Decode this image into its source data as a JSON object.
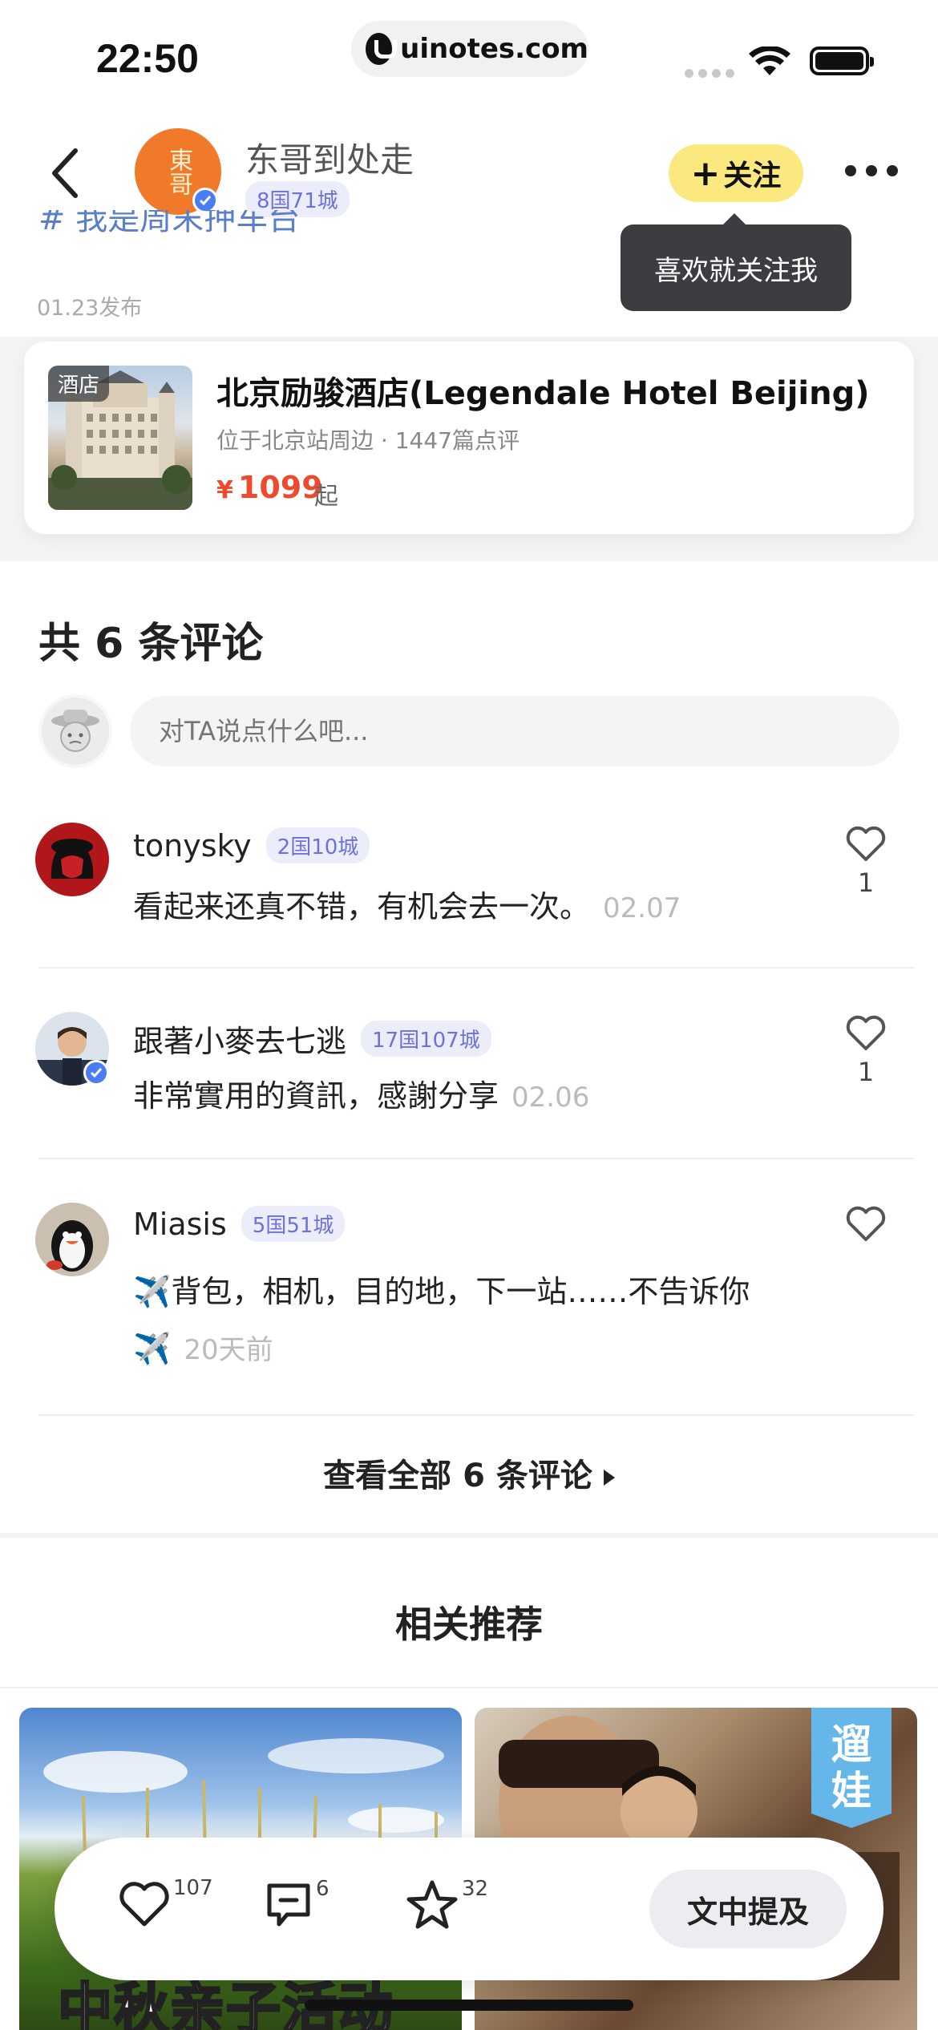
{
  "status_bar": {
    "time": "22:50",
    "url": "uinotes.com"
  },
  "header": {
    "author_name": "东哥到处走",
    "author_avatar_text": "東哥",
    "author_badge": "8国71城",
    "follow_label": "关注",
    "tooltip": "喜欢就关注我"
  },
  "post": {
    "truncated_text": "# 我是周末押车台",
    "publish_date": "01.23发布"
  },
  "hotel": {
    "tag": "酒店",
    "name": "北京励骏酒店(Legendale Hotel Beijing)",
    "location": "位于北京站周边 · 1447篇点评",
    "currency": "¥",
    "price": "1099",
    "price_suffix": "起"
  },
  "comments": {
    "title": "共 6 条评论",
    "input_placeholder": "对TA说点什么吧...",
    "items": [
      {
        "name": "tonysky",
        "badge": "2国10城",
        "text": "看起来还真不错，有机会去一次。",
        "date": "02.07",
        "likes": "1"
      },
      {
        "name": "跟著小麥去七逃",
        "badge": "17国107城",
        "text": "非常實用的資訊，感謝分享",
        "date": "02.06",
        "likes": "1"
      },
      {
        "name": "Miasis",
        "badge": "5国51城",
        "text": "✈️背包，相机，目的地，下一站……不告诉你",
        "text2": "✈️",
        "date": "20天前",
        "likes": ""
      }
    ],
    "view_all": "查看全部 6 条评论"
  },
  "recommend": {
    "title": "相关推荐",
    "card1_text": "中秋亲子活动",
    "card2_tag_line1": "遛",
    "card2_tag_line2": "娃"
  },
  "action_bar": {
    "likes": "107",
    "comments": "6",
    "favorites": "32",
    "mention_label": "文中提及"
  },
  "colors": {
    "accent_yellow": "#fbe87e",
    "price_red": "#ef4a2e",
    "badge_blue": "#6c72d8"
  }
}
